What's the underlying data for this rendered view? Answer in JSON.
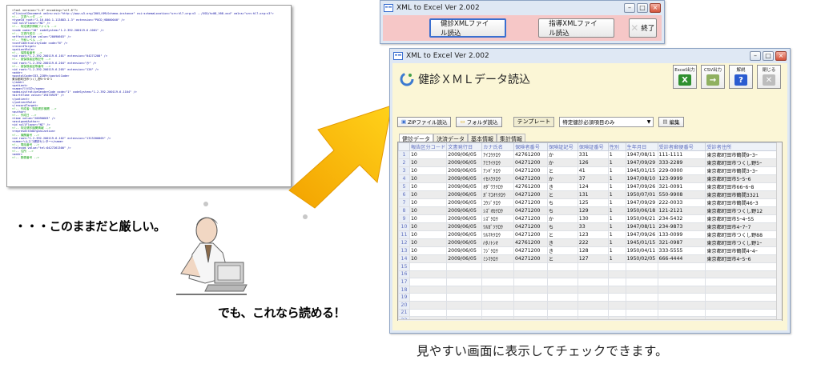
{
  "xml_document": {
    "lines": [
      {
        "t": "<?xml version=\"1.0\" encoding=\"utf-8\"?>",
        "k": "b"
      },
      {
        "t": "<ClinicalDocument xmlns:xsi=\"http://www.w3.org/2001/XMLSchema-instance\" xsi:schemaLocation=\"urn:hl7-org:v3 ../XSD/hc08_V08.xsd\" xmlns=\"urn:hl7-org:v3\">",
        "k": ""
      },
      {
        "t": "  <!-- 文書ヘッダ -->",
        "k": "c"
      },
      {
        "t": "  <typeId root=\"2.16.840.1.113883.1.3\" extension=\"POCD_HD000040\" />",
        "k": ""
      },
      {
        "t": "  <id nullFlavor=\"NI\" />",
        "k": ""
      },
      {
        "t": "  <!-- 特定健診情報ファイル -->",
        "k": "c"
      },
      {
        "t": "  <code code=\"10\" codeSystem=\"1.2.392.200119.6.1001\" />",
        "k": ""
      },
      {
        "t": "  <!-- 文書作成日 -->",
        "k": "c"
      },
      {
        "t": "  <effectiveTime value=\"20090603\" />",
        "k": ""
      },
      {
        "t": "  <!-- 守秘レベル -->",
        "k": "c"
      },
      {
        "t": "  <confidentialityCode code=\"N\" />",
        "k": ""
      },
      {
        "t": "  <recordTarget>",
        "k": ""
      },
      {
        "t": "    <patientRole>",
        "k": ""
      },
      {
        "t": "      <!-- 保険者番号 -->",
        "k": "c"
      },
      {
        "t": "      <id root=\"1.2.392.200119.6.101\" extension=\"04271200\" />",
        "k": ""
      },
      {
        "t": "      <!-- 被保険者証等記号 -->",
        "k": "c"
      },
      {
        "t": "      <id root=\"1.2.392.200119.6.204\" extension=\"か\" />",
        "k": ""
      },
      {
        "t": "      <!-- 被保険者証等番号 -->",
        "k": "c"
      },
      {
        "t": "      <id root=\"1.2.392.200119.6.205\" extension=\"126\" />",
        "k": ""
      },
      {
        "t": "      <addr>",
        "k": ""
      },
      {
        "t": "        <postalCode>333-2289</postalCode>",
        "k": ""
      },
      {
        "t": "        東京都町田市つくし野5ｰ5ｰ8ｰ1",
        "k": "b"
      },
      {
        "t": "      </addr>",
        "k": ""
      },
      {
        "t": "      <patient>",
        "k": ""
      },
      {
        "t": "        <name>ｱﾐﾗｲｸﾛｳ</name>",
        "k": ""
      },
      {
        "t": "        <administrativeGenderCode code=\"1\" codeSystem=\"1.2.392.200119.6.1104\" />",
        "k": ""
      },
      {
        "t": "        <birthTime value=\"19470929\" />",
        "k": ""
      },
      {
        "t": "      </patient>",
        "k": ""
      },
      {
        "t": "    </patientRole>",
        "k": ""
      },
      {
        "t": "  </recordTarget>",
        "k": ""
      },
      {
        "t": "  <!-- 作成者：特定健診機関 -->",
        "k": "c"
      },
      {
        "t": "  <author>",
        "k": ""
      },
      {
        "t": "    <!-- 作成日 -->",
        "k": "c"
      },
      {
        "t": "    <time value=\"20090603\" />",
        "k": ""
      },
      {
        "t": "    <assignedAuthor>",
        "k": ""
      },
      {
        "t": "      <id nullFlavor=\"NI\" />",
        "k": ""
      },
      {
        "t": "      <!-- 特定健診機関情報 -->",
        "k": "c"
      },
      {
        "t": "      <representedOrganization>",
        "k": ""
      },
      {
        "t": "        <!-- 機関番号 -->",
        "k": "c"
      },
      {
        "t": "        <id root=\"1.2.392.200119.6.102\" extension=\"1313200005\" />",
        "k": ""
      },
      {
        "t": "        <name>ヘルスコ健診センター</name>",
        "k": ""
      },
      {
        "t": "        <!-- 電話番号 -->",
        "k": "c"
      },
      {
        "t": "        <telecom value=\"tel:0427261300\" />",
        "k": ""
      },
      {
        "t": "        <!-- 住所 -->",
        "k": "c"
      },
      {
        "t": "        <addr>",
        "k": ""
      },
      {
        "t": "          <!-- 郵便番号 -->",
        "k": "c"
      }
    ]
  },
  "captions": {
    "left_top": "・・・このままだと厳しい。",
    "left_bottom": "でも、これなら読める！",
    "bottom": "見やすい画面に表示してチェックできます。"
  },
  "launcher": {
    "title": "XML to Excel  Ver 2.002",
    "buttons": [
      "健診XMLファイル読込",
      "指導XMLファイル読込"
    ],
    "exit_label": "終了"
  },
  "main_window": {
    "title": "XML to Excel  Ver 2.002",
    "heading": "健診ＸＭＬデータ読込",
    "tool_buttons": [
      {
        "label": "Excel出力",
        "icon": "excel-icon",
        "color": "#2f8f2f",
        "glyph": "X"
      },
      {
        "label": "CSV出力",
        "icon": "csv-export-icon",
        "color": "#8fb060",
        "glyph": "→"
      },
      {
        "label": "解説",
        "icon": "help-icon",
        "color": "#2a5bd0",
        "glyph": "?"
      },
      {
        "label": "閉じる",
        "icon": "close-icon",
        "color": "#bdbdbd",
        "glyph": "✕"
      }
    ],
    "zip_button": "ZIPファイル読込",
    "folder_button": "フォルダ読込",
    "template_label": "テンプレート",
    "template_value": "特定健診必須項目のみ",
    "edit_button": "編集",
    "tabs": [
      "健診データ",
      "決済データ",
      "基本情報",
      "集計情報"
    ],
    "columns": [
      "報告区分コード",
      "文書発行日",
      "カナ氏名",
      "保険者番号",
      "保険証記号",
      "保険証番号",
      "性別",
      "生年月日",
      "受診者郵便番号",
      "受診者住所"
    ],
    "rows": [
      [
        "10",
        "2009/06/05",
        "ｱｲｺｳｸﾛｳ",
        "42761200",
        "か",
        "331",
        "1",
        "1947/08/11",
        "111-1111",
        "東京都町田市鶴間9ｰ3ｰ"
      ],
      [
        "10",
        "2009/06/05",
        "ｱﾐﾗｲｸﾛｳ",
        "04271200",
        "か",
        "126",
        "1",
        "1947/09/29",
        "333-2289",
        "東京都町田市つくし野5ｰ"
      ],
      [
        "10",
        "2009/06/05",
        "ｱﾝｷﾞｸﾛｳ",
        "04271200",
        "と",
        "41",
        "1",
        "1945/01/15",
        "229-0000",
        "東京都町田市鶴間3ｰ3ｰ"
      ],
      [
        "10",
        "2009/06/05",
        "ｲｾﾊﾗｸﾛｳ",
        "04271200",
        "か",
        "37",
        "1",
        "1947/08/10",
        "123-9999",
        "東京都町田市5ｰ5ｰ6"
      ],
      [
        "10",
        "2009/06/05",
        "ｵﾀﾞﾜﾗｸﾛｳ",
        "42761200",
        "き",
        "124",
        "1",
        "1947/09/26",
        "321-0091",
        "東京都町田市66ｰ6ｰ8"
      ],
      [
        "10",
        "2009/06/05",
        "ｶﾞﾏｺｵﾘｸﾛｳ",
        "04271200",
        "と",
        "131",
        "1",
        "1950/07/01",
        "550-9908",
        "東京都町田市鶴間3321"
      ],
      [
        "10",
        "2009/06/05",
        "ｺｳｼﾞｸﾛｳ",
        "04271200",
        "ち",
        "125",
        "1",
        "1947/09/29",
        "222-0033",
        "東京都町田市鶴間46ｰ3"
      ],
      [
        "10",
        "2009/06/05",
        "ｼｽﾞｵｶｸﾛｳ",
        "04271200",
        "ち",
        "129",
        "1",
        "1950/06/18",
        "121-2121",
        "東京都町田市つくし野12"
      ],
      [
        "10",
        "2009/06/05",
        "ｼｽﾞｸﾛｳ",
        "04271200",
        "か",
        "130",
        "1",
        "1950/06/21",
        "234-5432",
        "東京都町田市5ｰ4ｰ55"
      ],
      [
        "10",
        "2009/06/05",
        "ﾂﾙｶﾞﾂｸﾛｳ",
        "04271200",
        "ち",
        "33",
        "1",
        "1947/08/11",
        "234-9873",
        "東京都町田市4ｰ7ｰ7"
      ],
      [
        "10",
        "2009/06/05",
        "ﾂﾙﾏｷｸﾛｳ",
        "04271200",
        "と",
        "123",
        "1",
        "1947/09/26",
        "133-0099",
        "東京都町田市つくし野88"
      ],
      [
        "10",
        "2009/06/05",
        "ﾊﾀﾉﾄｼｵ",
        "42761200",
        "き",
        "222",
        "1",
        "1945/01/15",
        "321-0987",
        "東京都町田市つくし野1ｰ"
      ],
      [
        "10",
        "2009/06/05",
        "ﾌｼﾞｸﾛｳ",
        "04271200",
        "き",
        "128",
        "1",
        "1950/04/11",
        "333-5555",
        "東京都町田市鶴間4ｰ4ｰ"
      ],
      [
        "10",
        "2009/06/05",
        "ﾐｼﾏｸﾛｳ",
        "04271200",
        "と",
        "127",
        "1",
        "1950/02/05",
        "666-4444",
        "東京都町田市4ｰ5ｰ6"
      ]
    ],
    "total_rows": 23
  }
}
